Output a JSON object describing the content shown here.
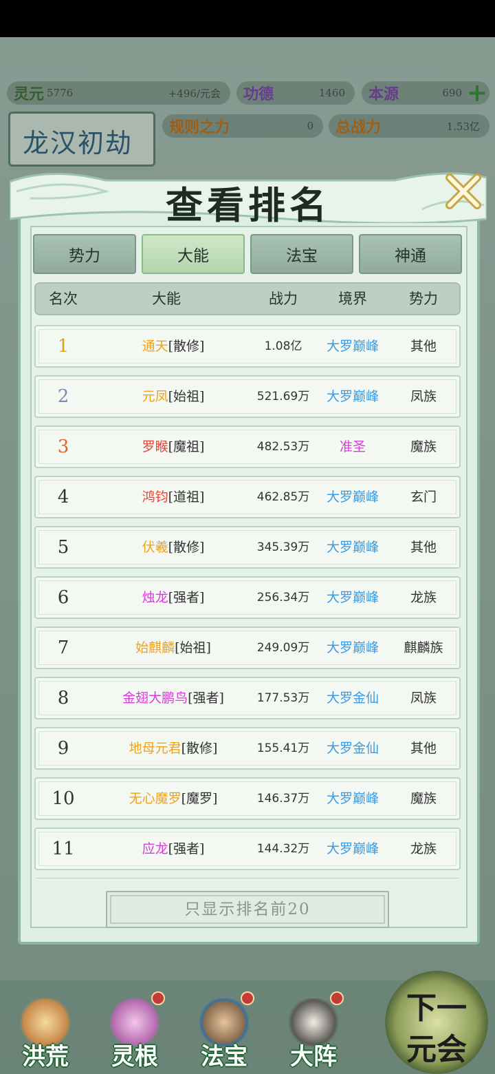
{
  "topbar": {
    "lingyuan": {
      "label": "灵元",
      "value": "5776",
      "rate": "+496/元会"
    },
    "gongde": {
      "label": "功德",
      "value": "1460"
    },
    "benyuan": {
      "label": "本源",
      "value": "690"
    },
    "guize": {
      "label": "规则之力",
      "value": "0"
    },
    "zongzhanli": {
      "label": "总战力",
      "value": "1.53亿"
    },
    "era": "龙汉初劫"
  },
  "modal": {
    "title": "查看排名",
    "tabs": [
      "势力",
      "大能",
      "法宝",
      "神通"
    ],
    "active_tab": "大能",
    "columns": [
      "名次",
      "大能",
      "战力",
      "境界",
      "势力"
    ],
    "rows": [
      {
        "rank": "1",
        "name": "通天",
        "tag": "[散修]",
        "power": "1.08亿",
        "realm": "大罗巅峰",
        "faction": "其他",
        "name_color": "#f0a21b",
        "realm_color": "#3b9ae1",
        "rank_color": "#d9a11c"
      },
      {
        "rank": "2",
        "name": "元凤",
        "tag": "[始祖]",
        "power": "521.69万",
        "realm": "大罗巅峰",
        "faction": "凤族",
        "name_color": "#f0a21b",
        "realm_color": "#3b9ae1",
        "rank_color": "#7a88b4"
      },
      {
        "rank": "3",
        "name": "罗睺",
        "tag": "[魔祖]",
        "power": "482.53万",
        "realm": "准圣",
        "faction": "魔族",
        "name_color": "#e8433a",
        "realm_color": "#d93bd9",
        "rank_color": "#e0622a"
      },
      {
        "rank": "4",
        "name": "鸿钧",
        "tag": "[道祖]",
        "power": "462.85万",
        "realm": "大罗巅峰",
        "faction": "玄门",
        "name_color": "#e8433a",
        "realm_color": "#3b9ae1",
        "rank_color": "#333333"
      },
      {
        "rank": "5",
        "name": "伏羲",
        "tag": "[散修]",
        "power": "345.39万",
        "realm": "大罗巅峰",
        "faction": "其他",
        "name_color": "#f0a21b",
        "realm_color": "#3b9ae1",
        "rank_color": "#333333"
      },
      {
        "rank": "6",
        "name": "烛龙",
        "tag": "[强者]",
        "power": "256.34万",
        "realm": "大罗巅峰",
        "faction": "龙族",
        "name_color": "#d93bd9",
        "realm_color": "#3b9ae1",
        "rank_color": "#333333"
      },
      {
        "rank": "7",
        "name": "始麒麟",
        "tag": "[始祖]",
        "power": "249.09万",
        "realm": "大罗巅峰",
        "faction": "麒麟族",
        "name_color": "#f0a21b",
        "realm_color": "#3b9ae1",
        "rank_color": "#333333"
      },
      {
        "rank": "8",
        "name": "金翅大鹏鸟",
        "tag": "[强者]",
        "power": "177.53万",
        "realm": "大罗金仙",
        "faction": "凤族",
        "name_color": "#d93bd9",
        "realm_color": "#3b9ae1",
        "rank_color": "#333333"
      },
      {
        "rank": "9",
        "name": "地母元君",
        "tag": "[散修]",
        "power": "155.41万",
        "realm": "大罗金仙",
        "faction": "其他",
        "name_color": "#f0a21b",
        "realm_color": "#3b9ae1",
        "rank_color": "#333333"
      },
      {
        "rank": "10",
        "name": "无心魔罗",
        "tag": "[魔罗]",
        "power": "146.37万",
        "realm": "大罗巅峰",
        "faction": "魔族",
        "name_color": "#f0a21b",
        "realm_color": "#3b9ae1",
        "rank_color": "#333333"
      },
      {
        "rank": "11",
        "name": "应龙",
        "tag": "[强者]",
        "power": "144.32万",
        "realm": "大罗巅峰",
        "faction": "龙族",
        "name_color": "#d93bd9",
        "realm_color": "#3b9ae1",
        "rank_color": "#333333"
      }
    ],
    "filter_label": "只显示排名前20"
  },
  "bottom_nav": {
    "items": [
      "洪荒",
      "灵根",
      "法宝",
      "大阵"
    ],
    "next_line1": "下一",
    "next_line2": "元会"
  }
}
